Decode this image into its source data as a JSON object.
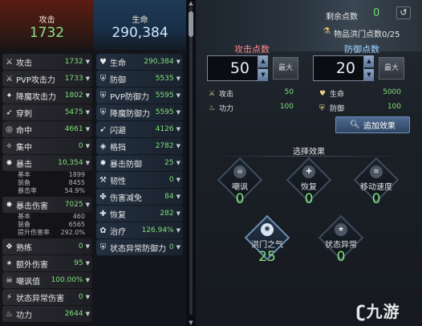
{
  "attack": {
    "label": "攻击",
    "value": "1732",
    "rows": [
      {
        "name": "攻击",
        "value": "1732",
        "icon": "crossed-swords-icon"
      },
      {
        "name": "PVP攻击力",
        "value": "1733",
        "icon": "pvp-sword-icon"
      },
      {
        "name": "降魔攻击力",
        "value": "1802",
        "icon": "demon-sword-icon"
      },
      {
        "name": "穿刺",
        "value": "5475",
        "icon": "pierce-icon"
      },
      {
        "name": "命中",
        "value": "4661",
        "icon": "target-icon"
      },
      {
        "name": "集中",
        "value": "0",
        "icon": "focus-icon"
      },
      {
        "name": "暴击",
        "value": "10,354",
        "icon": "critical-icon"
      },
      {
        "name": "暴击伤害",
        "value": "7025",
        "icon": "critical-damage-icon"
      },
      {
        "name": "熟练",
        "value": "0",
        "icon": "mastery-icon"
      },
      {
        "name": "额外伤害",
        "value": "95",
        "icon": "extra-damage-icon"
      },
      {
        "name": "嘲讽值",
        "value": "100.00%",
        "icon": "taunt-icon"
      },
      {
        "name": "状态异常伤害",
        "value": "0",
        "icon": "status-damage-icon"
      },
      {
        "name": "功力",
        "value": "2644",
        "icon": "power-icon"
      }
    ],
    "crit_details": [
      {
        "label": "基本",
        "value": "1899"
      },
      {
        "label": "装备",
        "value": "8455"
      },
      {
        "label": "暴击率",
        "value": "54.9%"
      }
    ],
    "critdmg_details": [
      {
        "label": "基本",
        "value": "460"
      },
      {
        "label": "装备",
        "value": "6565"
      },
      {
        "label": "提升伤害率",
        "value": "292.0%"
      }
    ]
  },
  "defense": {
    "label": "生命",
    "value": "290,384",
    "rows": [
      {
        "name": "生命",
        "value": "290,384",
        "icon": "heart-icon"
      },
      {
        "name": "防御",
        "value": "5535",
        "icon": "shield-icon"
      },
      {
        "name": "PVP防御力",
        "value": "5595",
        "icon": "pvp-shield-icon"
      },
      {
        "name": "降魔防御力",
        "value": "5595",
        "icon": "demon-shield-icon"
      },
      {
        "name": "闪避",
        "value": "4126",
        "icon": "evade-icon"
      },
      {
        "name": "格挡",
        "value": "2782",
        "icon": "block-icon"
      },
      {
        "name": "暴击防御",
        "value": "25",
        "icon": "crit-defense-icon"
      },
      {
        "name": "韧性",
        "value": "0",
        "icon": "tenacity-icon"
      },
      {
        "name": "伤害减免",
        "value": "84",
        "icon": "damage-reduction-icon"
      },
      {
        "name": "恢复",
        "value": "282",
        "icon": "recovery-icon"
      },
      {
        "name": "治疗",
        "value": "126.94%",
        "icon": "heal-icon"
      },
      {
        "name": "状态异常防御力",
        "value": "0",
        "icon": "status-defense-icon"
      }
    ]
  },
  "panel": {
    "remaining_label": "剩余点数",
    "remaining_value": "0",
    "item_label": "物品洪门点数0/25",
    "attack_points_label": "攻击点数",
    "attack_points_value": "50",
    "defense_points_label": "防御点数",
    "defense_points_value": "20",
    "max_label": "最大",
    "attack_effects": [
      {
        "name": "攻击",
        "value": "50"
      },
      {
        "name": "功力",
        "value": "100"
      }
    ],
    "defense_effects": [
      {
        "name": "生命",
        "value": "5000"
      },
      {
        "name": "防御",
        "value": "100"
      }
    ],
    "add_effect_label": "追加效果",
    "select_effect_label": "选择效果",
    "nodes": [
      {
        "name": "嘲讽",
        "value": "0"
      },
      {
        "name": "恢复",
        "value": "0"
      },
      {
        "name": "移动速度",
        "value": "0"
      },
      {
        "name": "洪门之气",
        "value": "25"
      },
      {
        "name": "状态异常",
        "value": "0"
      }
    ]
  },
  "watermark": "九游",
  "colors": {
    "green_value": "#7fe07a",
    "attack_points": "#ff8a8a"
  }
}
